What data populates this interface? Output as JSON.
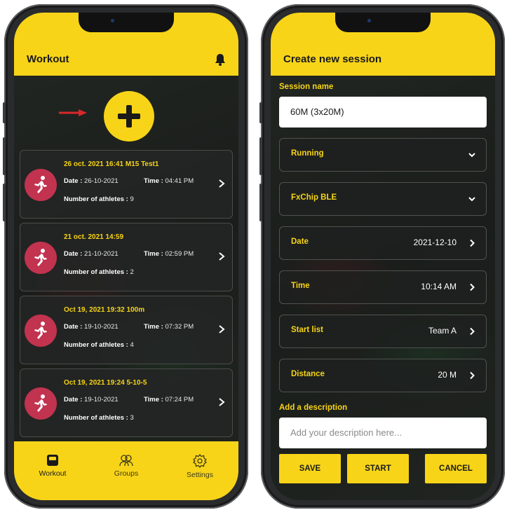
{
  "workout_screen": {
    "title": "Workout",
    "sessions": [
      {
        "title": "26 oct. 2021 16:41 M15 Test1",
        "date_label": "Date :",
        "date": "26-10-2021",
        "time_label": "Time :",
        "time": "04:41 PM",
        "athletes_label": "Number of athletes :",
        "athletes": "9"
      },
      {
        "title": "21 oct. 2021 14:59",
        "date_label": "Date :",
        "date": "21-10-2021",
        "time_label": "Time :",
        "time": "02:59 PM",
        "athletes_label": "Number of athletes :",
        "athletes": "2"
      },
      {
        "title": "Oct 19, 2021 19:32  100m",
        "date_label": "Date :",
        "date": "19-10-2021",
        "time_label": "Time :",
        "time": "07:32 PM",
        "athletes_label": "Number of athletes :",
        "athletes": "4"
      },
      {
        "title": "Oct 19, 2021 19:24 5-10-5",
        "date_label": "Date :",
        "date": "19-10-2021",
        "time_label": "Time :",
        "time": "07:24 PM",
        "athletes_label": "Number of athletes :",
        "athletes": "3"
      }
    ],
    "nav": [
      {
        "label": "Workout",
        "icon": "inbox-icon",
        "active": true
      },
      {
        "label": "Groups",
        "icon": "group-icon",
        "active": false
      },
      {
        "label": "Settings",
        "icon": "gear-icon",
        "active": false
      }
    ]
  },
  "session_screen": {
    "title": "Create new session",
    "session_name_label": "Session name",
    "session_name_value": "60M (3x20M)",
    "rows": [
      {
        "label": "Running",
        "value": "",
        "icon": "chevron-down-icon"
      },
      {
        "label": "FxChip BLE",
        "value": "",
        "icon": "chevron-down-icon"
      },
      {
        "label": "Date",
        "value": "2021-12-10",
        "icon": "chevron-right-icon"
      },
      {
        "label": "Time",
        "value": "10:14 AM",
        "icon": "chevron-right-icon"
      },
      {
        "label": "Start list",
        "value": "Team A",
        "icon": "chevron-right-icon"
      },
      {
        "label": "Distance",
        "value": "20 M",
        "icon": "chevron-right-icon"
      }
    ],
    "description_label": "Add a description",
    "description_placeholder": "Add your description here...",
    "buttons": {
      "save": "SAVE",
      "start": "START",
      "cancel": "CANCEL"
    }
  },
  "colors": {
    "accent": "#f7d418",
    "avatar": "#c2334f",
    "arrow": "#d8282a"
  }
}
